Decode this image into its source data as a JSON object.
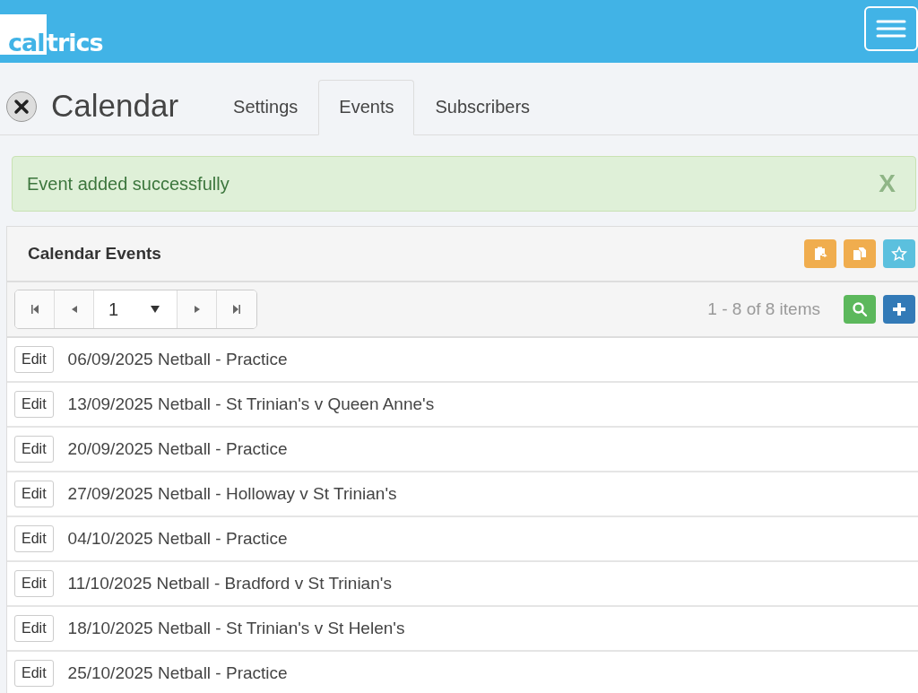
{
  "header": {
    "logo": {
      "boxed": "cal",
      "rest": "trics"
    }
  },
  "page": {
    "title": "Calendar",
    "tabs": [
      {
        "label": "Settings",
        "selected": false
      },
      {
        "label": "Events",
        "selected": true
      },
      {
        "label": "Subscribers",
        "selected": false
      }
    ]
  },
  "alert": {
    "message": "Event added successfully",
    "close": "X"
  },
  "panel": {
    "title": "Calendar Events",
    "tool_buttons": [
      {
        "kind": "paste"
      },
      {
        "kind": "copy"
      },
      {
        "kind": "star"
      }
    ],
    "pager": {
      "page": "1",
      "summary": "1 - 8 of 8 items"
    },
    "rows": [
      {
        "action": "Edit",
        "text": "06/09/2025 Netball - Practice"
      },
      {
        "action": "Edit",
        "text": "13/09/2025 Netball - St Trinian's v Queen Anne's"
      },
      {
        "action": "Edit",
        "text": "20/09/2025 Netball - Practice"
      },
      {
        "action": "Edit",
        "text": "27/09/2025 Netball - Holloway v St Trinian's"
      },
      {
        "action": "Edit",
        "text": "04/10/2025 Netball - Practice"
      },
      {
        "action": "Edit",
        "text": "11/10/2025 Netball - Bradford v St Trinian's"
      },
      {
        "action": "Edit",
        "text": "18/10/2025 Netball - St Trinian's v St Helen's"
      },
      {
        "action": "Edit",
        "text": "25/10/2025 Netball - Practice"
      }
    ]
  }
}
